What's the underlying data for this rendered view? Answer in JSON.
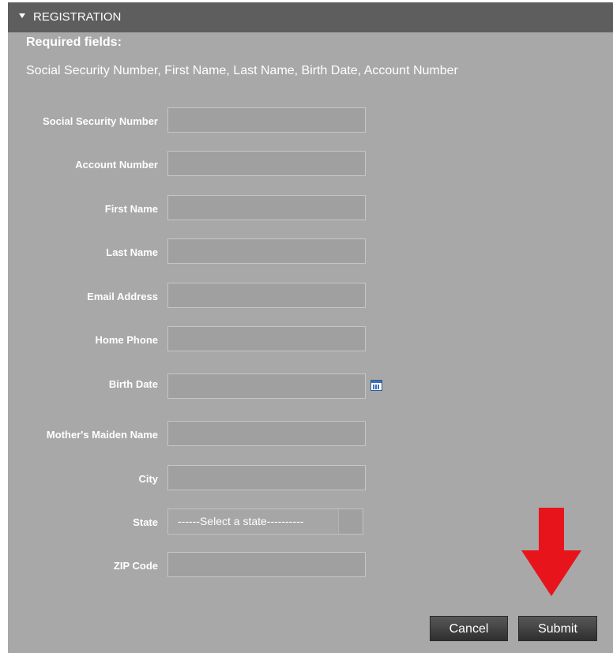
{
  "section": {
    "title": "REGISTRATION"
  },
  "required": {
    "title": "Required fields:",
    "list": "Social Security Number, First Name, Last Name, Birth Date, Account Number"
  },
  "fields": {
    "ssn": {
      "label": "Social Security Number",
      "value": ""
    },
    "account": {
      "label": "Account Number",
      "value": ""
    },
    "first_name": {
      "label": "First Name",
      "value": ""
    },
    "last_name": {
      "label": "Last Name",
      "value": ""
    },
    "email": {
      "label": "Email Address",
      "value": ""
    },
    "home_phone": {
      "label": "Home Phone",
      "value": ""
    },
    "birth_date": {
      "label": "Birth Date",
      "value": ""
    },
    "maiden_name": {
      "label": "Mother's Maiden Name",
      "value": ""
    },
    "city": {
      "label": "City",
      "value": ""
    },
    "state": {
      "label": "State",
      "selected": "------Select a state----------"
    },
    "zip": {
      "label": "ZIP Code",
      "value": ""
    }
  },
  "buttons": {
    "cancel": "Cancel",
    "submit": "Submit"
  },
  "icons": {
    "calendar": "calendar-icon",
    "arrow": "red-down-arrow"
  },
  "colors": {
    "panel": "#a8a8a8",
    "header": "#5e5e5e",
    "arrow": "#e8141c"
  }
}
